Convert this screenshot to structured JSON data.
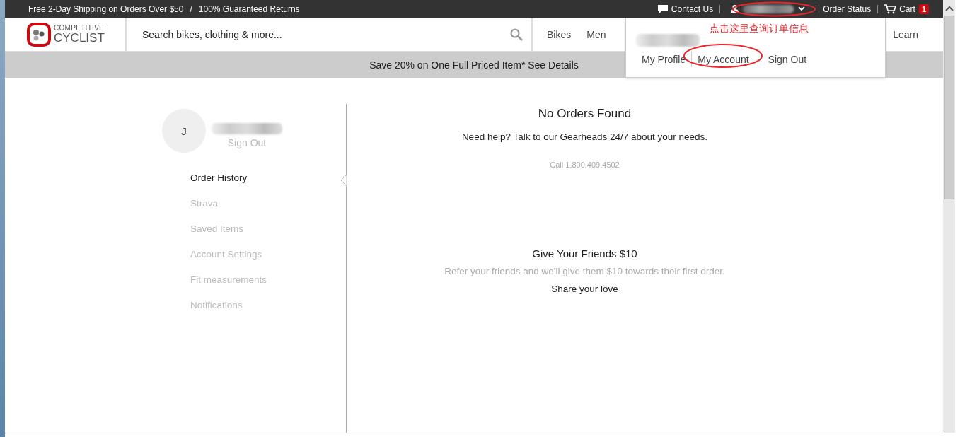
{
  "top_bar": {
    "shipping": "Free 2-Day Shipping on Orders Over $50",
    "separator": "/",
    "returns": "100% Guaranteed Returns",
    "contact": "Contact Us",
    "account_menu": {
      "expanded": true
    },
    "order_status": "Order Status",
    "cart": {
      "label": "Cart",
      "count": "1"
    }
  },
  "header": {
    "logo": {
      "line1": "COMPETITIVE",
      "line2": "CYCLIST"
    },
    "search": {
      "placeholder": "Search bikes, clothing & more..."
    },
    "nav": [
      "Bikes",
      "Men"
    ],
    "nav_right": "Learn"
  },
  "promo_banner": "Save 20% on One Full Priced Item* See Details",
  "account_dropdown": {
    "links": [
      {
        "label": "My Profile",
        "highlighted": false
      },
      {
        "label": "My Account",
        "highlighted": true
      },
      {
        "label": "Sign Out",
        "highlighted": false
      }
    ]
  },
  "annotation": {
    "note": "点击这里查询订单信息"
  },
  "profile": {
    "initial": "J",
    "sign_out": "Sign Out"
  },
  "account_menu_items": [
    {
      "label": "Order History",
      "selected": true
    },
    {
      "label": "Strava",
      "selected": false
    },
    {
      "label": "Saved Items",
      "selected": false
    },
    {
      "label": "Account Settings",
      "selected": false
    },
    {
      "label": "Fit measurements",
      "selected": false
    },
    {
      "label": "Notifications",
      "selected": false
    }
  ],
  "orders": {
    "title": "No Orders Found",
    "help": "Need help? Talk to our Gearheads 24/7 about your needs.",
    "phone": "Call 1.800.409.4502"
  },
  "referral": {
    "title": "Give Your Friends $10",
    "text": "Refer your friends and we'll give them $10 towards their first order.",
    "link": "Share your love"
  }
}
